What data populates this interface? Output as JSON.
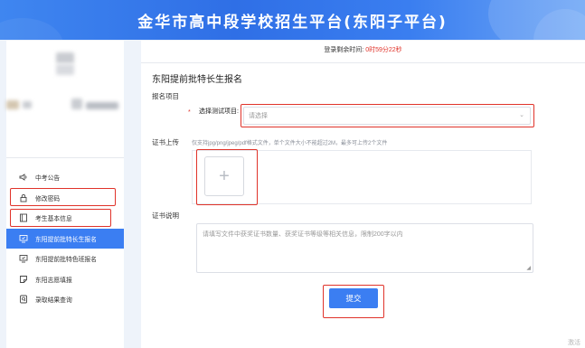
{
  "header": {
    "title": "金华市高中段学校招生平台(东阳子平台)"
  },
  "sidebar": {
    "items": [
      {
        "label": "中考公告",
        "icon": "speaker-icon"
      },
      {
        "label": "修改密码",
        "icon": "lock-icon"
      },
      {
        "label": "考生基本信息",
        "icon": "id-card-icon"
      },
      {
        "label": "东阳提前批特长生报名",
        "icon": "monitor-icon",
        "active": true
      },
      {
        "label": "东阳提前批特色班报名",
        "icon": "monitor-icon"
      },
      {
        "label": "东阳志愿填报",
        "icon": "edit-icon"
      },
      {
        "label": "录取结果查询",
        "icon": "search-doc-icon"
      }
    ]
  },
  "main": {
    "timer_label": "登录剩余时间: ",
    "timer_value": "0时59分22秒",
    "page_title": "东阳提前批特长生报名",
    "section_project": "报名项目",
    "select_required_mark": "*",
    "select_label": "选择测试项目:",
    "select_placeholder": "请选择",
    "section_cert": "证书上传",
    "upload_hint": "仅支持jpg/png/jpeg/pdf格式文件，单个文件大小不能超过2M，最多可上传2个文件",
    "upload_plus": "+",
    "section_desc": "证书说明",
    "desc_placeholder": "请填写文件中获奖证书数量、获奖证书等级等相关信息，限制200字以内",
    "submit_label": "提交"
  },
  "watermark": "激活",
  "colors": {
    "primary": "#3b7ef2",
    "highlight": "#e0332a"
  }
}
